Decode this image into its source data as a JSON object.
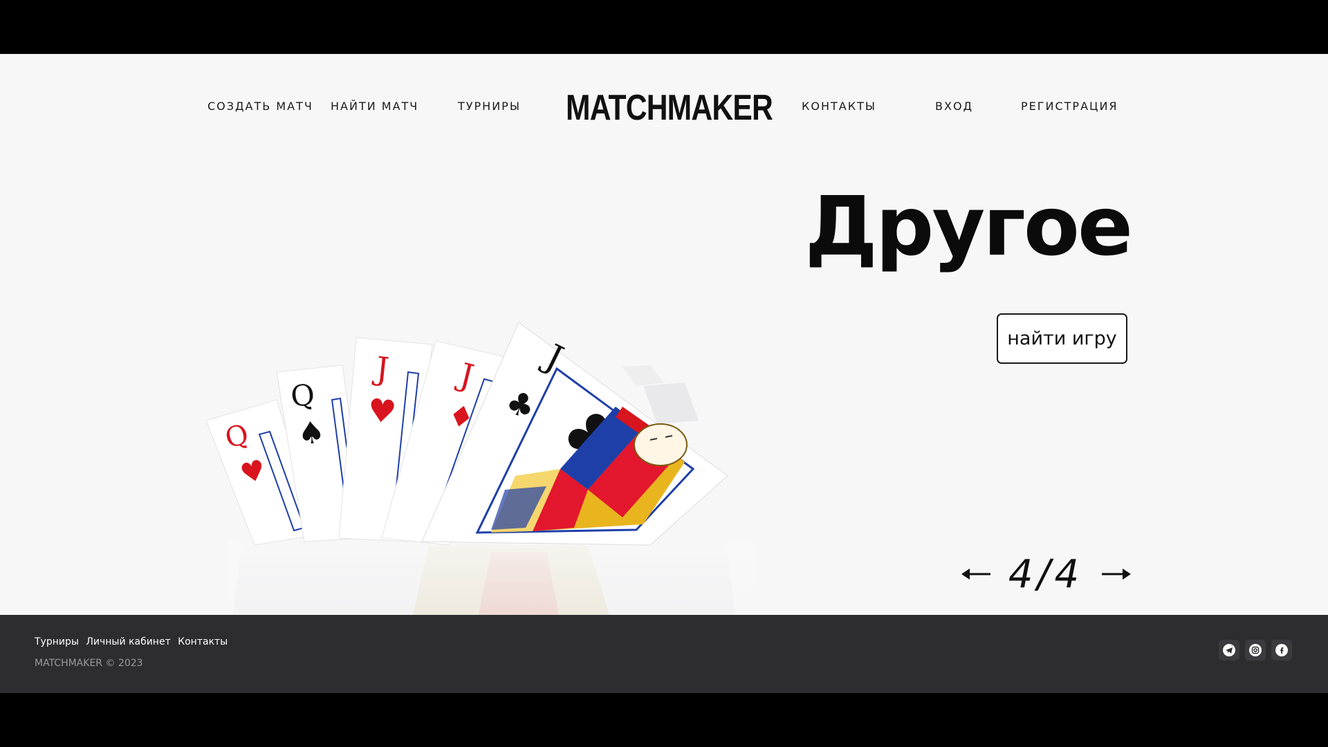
{
  "nav": {
    "left": [
      "СОЗДАТЬ МАТЧ",
      "НАЙТИ МАТЧ",
      "ТУРНИРЫ"
    ],
    "right": [
      "КОНТАКТЫ",
      "ВХОД",
      "РЕГИСТРАЦИЯ"
    ],
    "logo": "MATCHMAKER"
  },
  "hero": {
    "title": "Другое",
    "cta_label": "найти игру",
    "image": "playing-cards-fan"
  },
  "slider": {
    "current": "4",
    "separator": "/",
    "total": "4",
    "prev_icon": "arrow-left-icon",
    "next_icon": "arrow-right-icon"
  },
  "footer": {
    "links": [
      "Турниры",
      "Личный кабинет",
      "Контакты"
    ],
    "copyright": "MATCHMAKER © 2023",
    "social": [
      "telegram-icon",
      "instagram-icon",
      "facebook-icon"
    ]
  },
  "colors": {
    "page_bg": "#f7f7f7",
    "footer_bg": "#2d2d30",
    "text": "#111111",
    "card_red": "#e3172d",
    "card_blue": "#1f3fa8",
    "card_gold": "#e9b51f"
  }
}
